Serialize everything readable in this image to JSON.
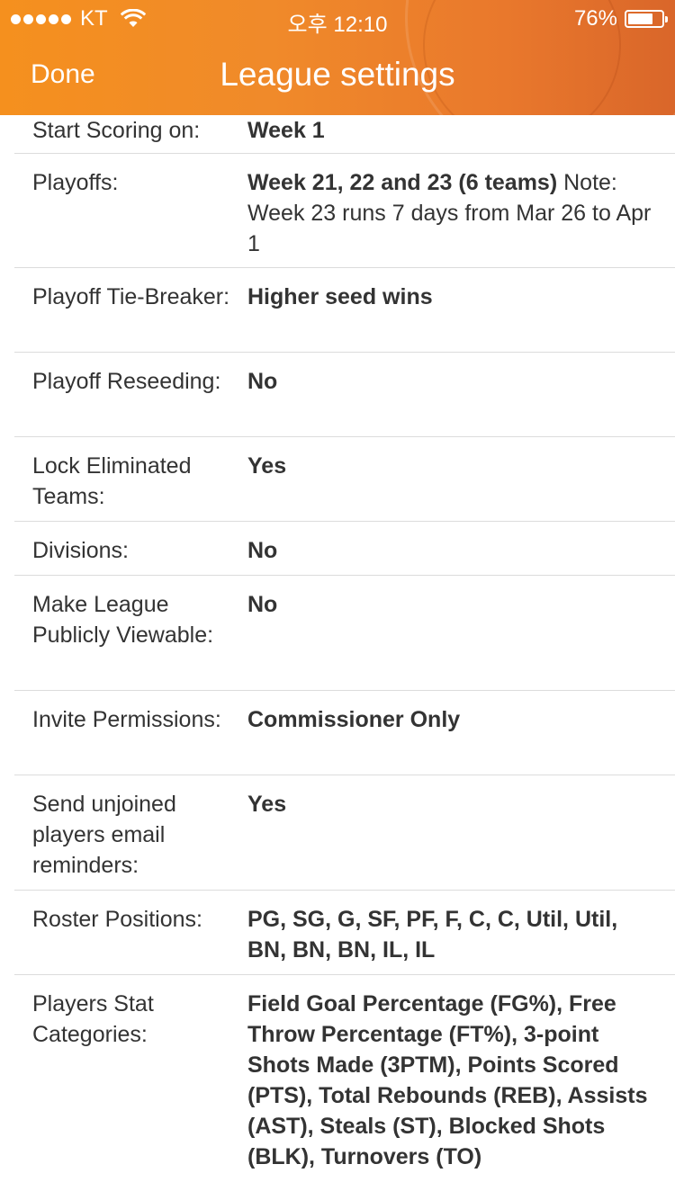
{
  "status_bar": {
    "carrier": "KT",
    "time": "오후 12:10",
    "battery": "76%",
    "battery_level": 0.76
  },
  "nav": {
    "done_label": "Done",
    "title": "League settings"
  },
  "settings": [
    {
      "label": "Start Scoring on:",
      "value": "Week 1",
      "note": ""
    },
    {
      "label": "Playoffs:",
      "value": "Week 21, 22 and 23 (6 teams)",
      "note": " Note: Week 23 runs 7 days from Mar 26 to Apr 1"
    },
    {
      "label": "Playoff Tie-Breaker:",
      "value": "Higher seed wins",
      "note": ""
    },
    {
      "label": "Playoff Reseeding:",
      "value": "No",
      "note": ""
    },
    {
      "label": "Lock Eliminated Teams:",
      "value": "Yes",
      "note": ""
    },
    {
      "label": "Divisions:",
      "value": "No",
      "note": ""
    },
    {
      "label": "Make League Publicly Viewable:",
      "value": "No",
      "note": ""
    },
    {
      "label": "Invite Permissions:",
      "value": "Commissioner Only",
      "note": ""
    },
    {
      "label": "Send unjoined players email reminders:",
      "value": "Yes",
      "note": ""
    },
    {
      "label": "Roster Positions:",
      "value": "PG, SG, G, SF, PF, F, C, C, Util, Util, BN, BN, BN, IL, IL",
      "note": ""
    },
    {
      "label": "Players Stat Categories:",
      "value": "Field Goal Percentage (FG%), Free Throw Percentage (FT%), 3-point Shots Made (3PTM), Points Scored (PTS), Total Rebounds (REB), Assists (AST), Steals (ST), Blocked Shots (BLK), Turnovers (TO)",
      "note": ""
    }
  ]
}
